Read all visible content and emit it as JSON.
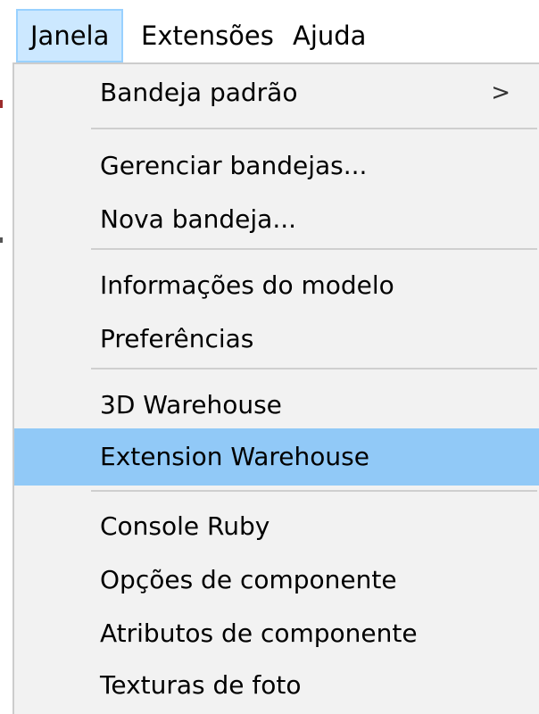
{
  "menubar": {
    "items": [
      {
        "label": "Janela"
      },
      {
        "label": "Extensões"
      },
      {
        "label": "Ajuda"
      }
    ]
  },
  "menu": {
    "items": [
      {
        "label": "Bandeja padrão",
        "submenu_arrow": ">"
      },
      {
        "label": "Gerenciar bandejas..."
      },
      {
        "label": "Nova bandeja..."
      },
      {
        "label": "Informações do modelo"
      },
      {
        "label": "Preferências"
      },
      {
        "label": "3D Warehouse"
      },
      {
        "label": "Extension Warehouse"
      },
      {
        "label": "Console Ruby"
      },
      {
        "label": "Opções de componente"
      },
      {
        "label": "Atributos de componente"
      },
      {
        "label": "Texturas de foto"
      }
    ],
    "highlighted_item": "Extension Warehouse"
  },
  "colors": {
    "menu_background": "#f2f2f2",
    "highlight": "#91c9f7",
    "menubar_open": "#cce8ff",
    "separator": "#cfcfcf"
  }
}
